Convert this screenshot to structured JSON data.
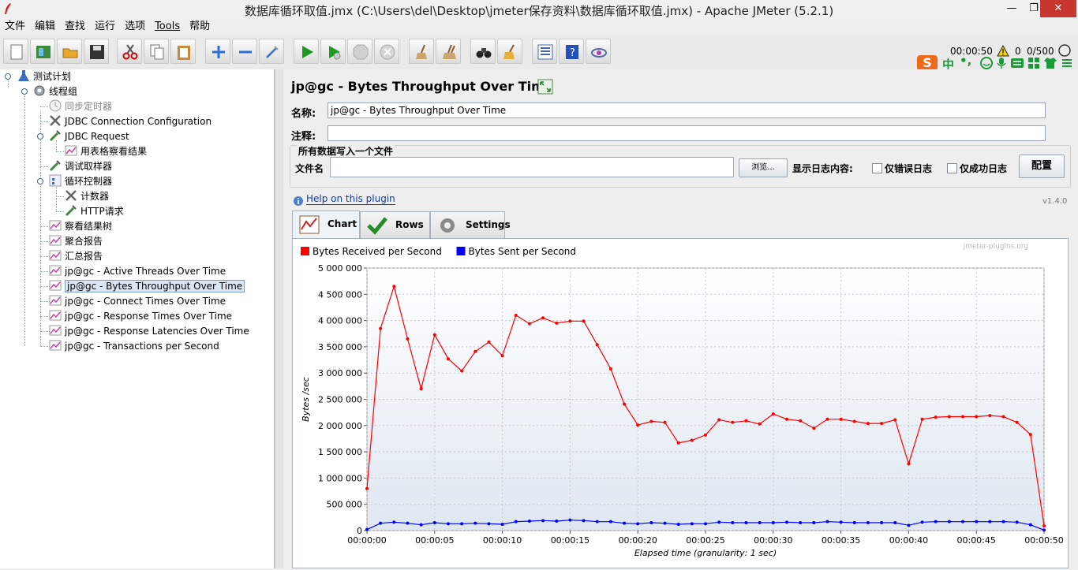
{
  "window": {
    "title": "数据库循环取值.jmx (C:\\Users\\del\\Desktop\\jmeter保存资料\\数据库循环取值.jmx) - Apache JMeter (5.2.1)",
    "btn_min": "—",
    "btn_max": "❐",
    "btn_close": "✕"
  },
  "menu": [
    "文件",
    "编辑",
    "查找",
    "运行",
    "选项",
    "Tools",
    "帮助"
  ],
  "status": {
    "elapsed": "00:00:50",
    "warnings": "0",
    "threads": "0/500"
  },
  "ime": {
    "logo": "S",
    "lang": "中",
    "punct": "•,"
  },
  "tree": [
    {
      "label": "测试计划"
    },
    {
      "label": "线程组"
    },
    {
      "label": "同步定时器"
    },
    {
      "label": "JDBC Connection Configuration"
    },
    {
      "label": "JDBC Request"
    },
    {
      "label": "用表格察看结果"
    },
    {
      "label": "调试取样器"
    },
    {
      "label": "循环控制器"
    },
    {
      "label": "计数器"
    },
    {
      "label": "HTTP请求"
    },
    {
      "label": "察看结果树"
    },
    {
      "label": "聚合报告"
    },
    {
      "label": "汇总报告"
    },
    {
      "label": "jp@gc - Active Threads Over Time"
    },
    {
      "label": "jp@gc - Bytes Throughput Over Time"
    },
    {
      "label": "jp@gc - Connect Times Over Time"
    },
    {
      "label": "jp@gc - Response Times Over Time"
    },
    {
      "label": "jp@gc - Response Latencies Over Time"
    },
    {
      "label": "jp@gc - Transactions per Second"
    }
  ],
  "panel": {
    "header": "jp@gc - Bytes Throughput Over Time",
    "name_label": "名称:",
    "name_value": "jp@gc - Bytes Throughput Over Time",
    "comment_label": "注释:",
    "comment_value": "",
    "group_title": "所有数据写入一个文件",
    "file_label": "文件名",
    "file_value": "",
    "browse": "浏览...",
    "log_label": "显示日志内容:",
    "errors_only": "仅错误日志",
    "success_only": "仅成功日志",
    "configure": "配置",
    "help_link": "Help on this plugin",
    "version": "v1.4.0",
    "tabs": [
      "Chart",
      "Rows",
      "Settings"
    ]
  },
  "chart_data": {
    "type": "line",
    "watermark": "jmeter-plugins.org",
    "xlabel": "Elapsed time (granularity: 1 sec)",
    "ylabel": "Bytes /sec",
    "xlim": [
      0,
      50
    ],
    "ylim": [
      0,
      5000000
    ],
    "x_ticks": [
      "00:00:00",
      "00:00:05",
      "00:00:10",
      "00:00:15",
      "00:00:20",
      "00:00:25",
      "00:00:30",
      "00:00:35",
      "00:00:40",
      "00:00:45",
      "00:00:50"
    ],
    "y_ticks": [
      "0",
      "500 000",
      "1 000 000",
      "1 500 000",
      "2 000 000",
      "2 500 000",
      "3 000 000",
      "3 500 000",
      "4 000 000",
      "4 500 000",
      "5 000 000"
    ],
    "grid": true,
    "legend": "top-left",
    "series": [
      {
        "name": "Bytes Received per Second",
        "color": "#ff0000",
        "x": [
          0,
          1,
          2,
          3,
          4,
          5,
          6,
          7,
          8,
          9,
          10,
          11,
          12,
          13,
          14,
          15,
          16,
          17,
          18,
          19,
          20,
          21,
          22,
          23,
          24,
          25,
          26,
          27,
          28,
          29,
          30,
          31,
          32,
          33,
          34,
          35,
          36,
          37,
          38,
          39,
          40,
          41,
          42,
          43,
          44,
          45,
          46,
          47,
          48,
          49,
          50
        ],
        "values": [
          800000,
          3850000,
          4650000,
          3650000,
          2700000,
          3730000,
          3270000,
          3040000,
          3410000,
          3590000,
          3330000,
          4100000,
          3940000,
          4050000,
          3950000,
          3990000,
          3990000,
          3540000,
          3080000,
          2410000,
          2010000,
          2080000,
          2060000,
          1670000,
          1720000,
          1820000,
          2110000,
          2060000,
          2090000,
          2030000,
          2220000,
          2120000,
          2090000,
          1950000,
          2120000,
          2120000,
          2080000,
          2040000,
          2040000,
          2110000,
          1270000,
          2120000,
          2160000,
          2170000,
          2170000,
          2170000,
          2190000,
          2170000,
          2060000,
          1830000,
          90000
        ]
      },
      {
        "name": "Bytes Sent per Second",
        "color": "#0000ff",
        "x": [
          0,
          1,
          2,
          3,
          4,
          5,
          6,
          7,
          8,
          9,
          10,
          11,
          12,
          13,
          14,
          15,
          16,
          17,
          18,
          19,
          20,
          21,
          22,
          23,
          24,
          25,
          26,
          27,
          28,
          29,
          30,
          31,
          32,
          33,
          34,
          35,
          36,
          37,
          38,
          39,
          40,
          41,
          42,
          43,
          44,
          45,
          46,
          47,
          48,
          49,
          50
        ],
        "values": [
          20000,
          140000,
          160000,
          140000,
          110000,
          150000,
          130000,
          130000,
          140000,
          130000,
          120000,
          170000,
          180000,
          190000,
          180000,
          200000,
          190000,
          170000,
          170000,
          140000,
          130000,
          150000,
          140000,
          120000,
          130000,
          130000,
          160000,
          150000,
          150000,
          150000,
          150000,
          160000,
          150000,
          150000,
          170000,
          160000,
          150000,
          150000,
          150000,
          150000,
          100000,
          160000,
          170000,
          170000,
          170000,
          170000,
          170000,
          170000,
          160000,
          110000,
          10000
        ]
      }
    ]
  }
}
